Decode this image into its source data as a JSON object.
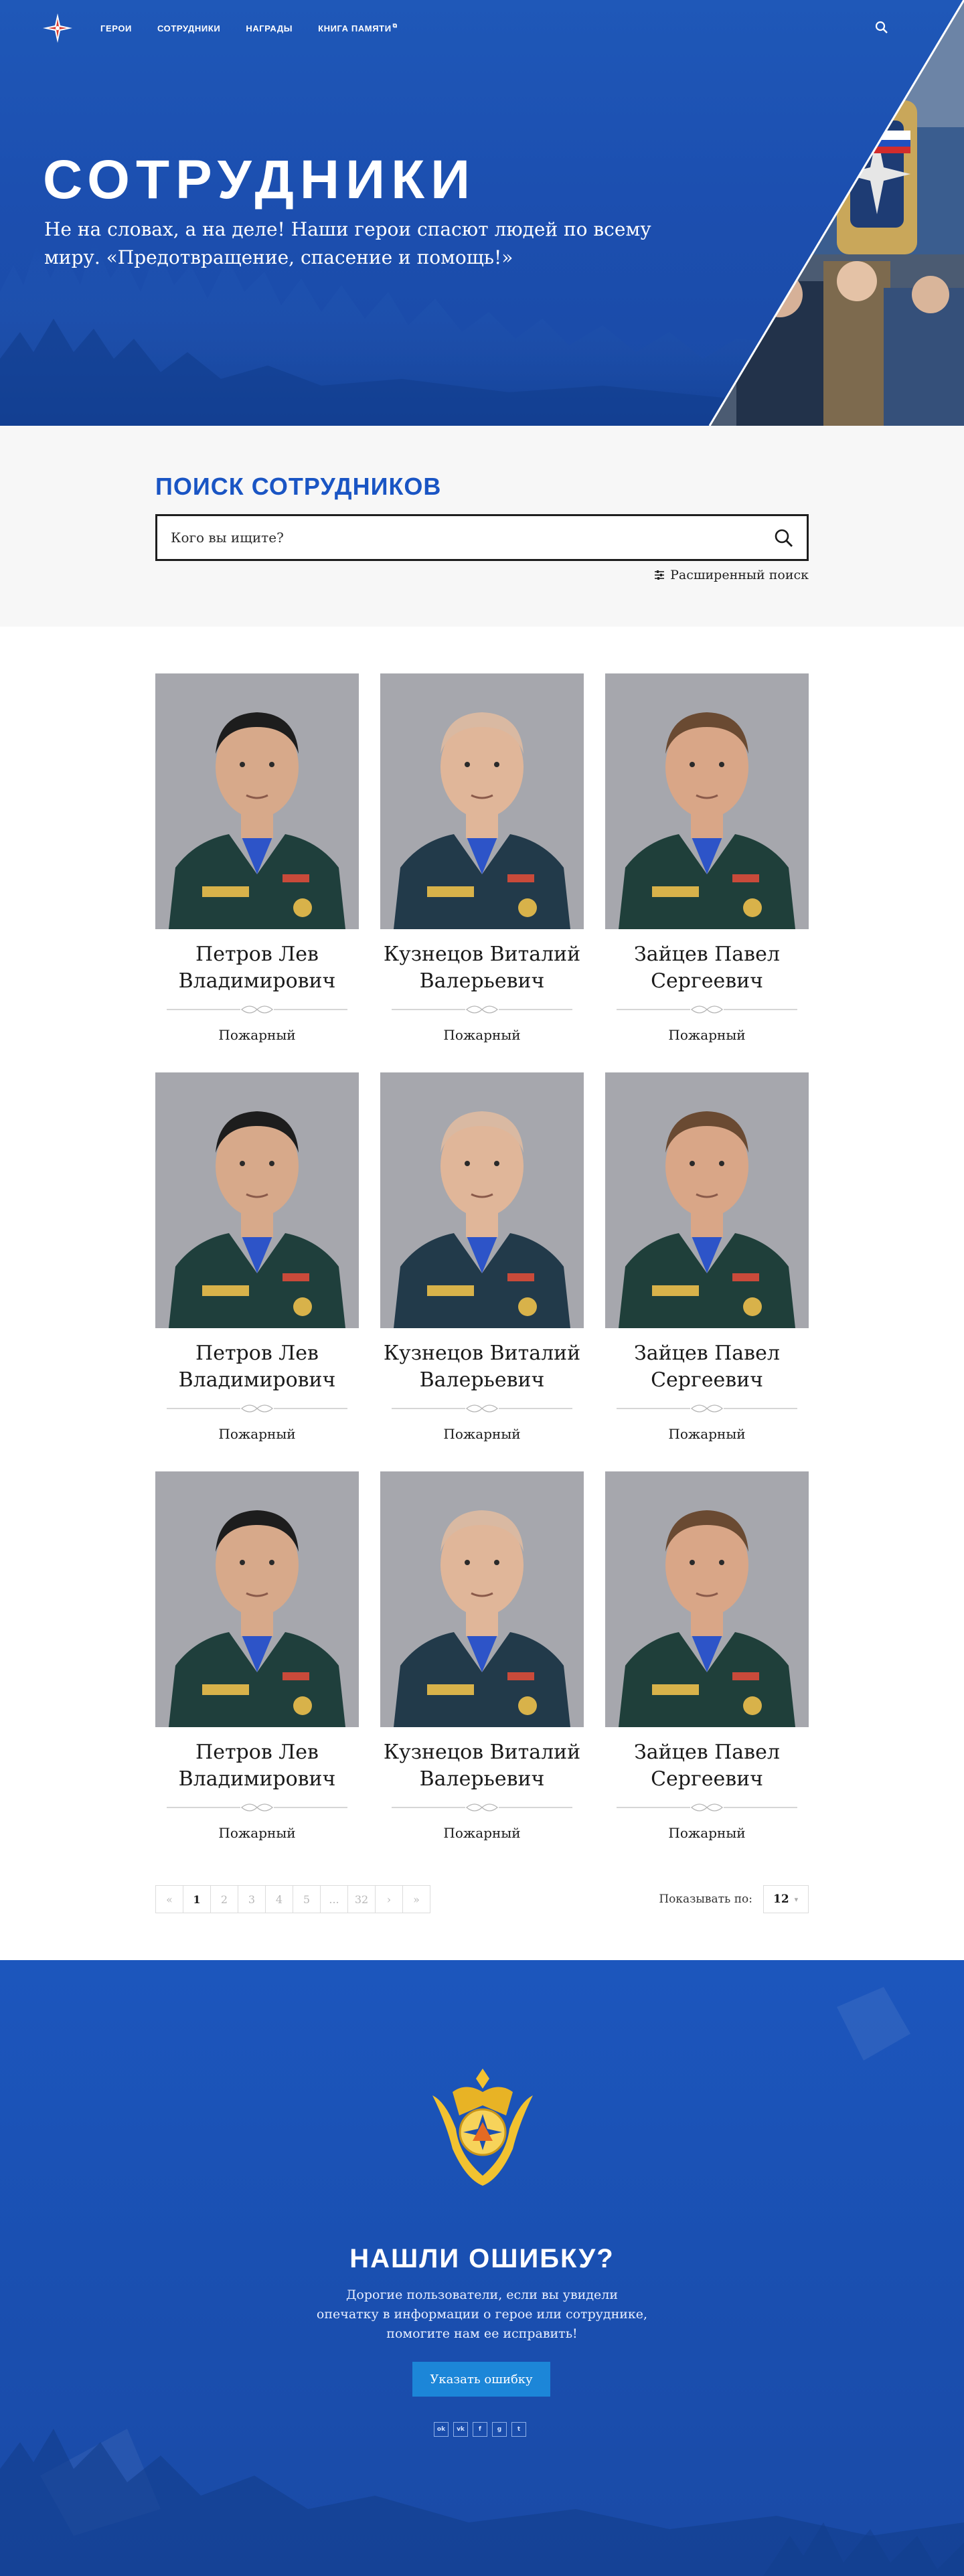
{
  "header": {
    "nav": [
      "Герои",
      "Сотрудники",
      "Награды",
      "Книга памяти"
    ],
    "nav_icons": [
      "logo-star-icon",
      "search-icon",
      "external-link-icon"
    ]
  },
  "hero": {
    "title": "СОТРУДНИКИ",
    "subtitle": "Не на словах, а на деле! Наши герои спасют людей по всему миру. «Предотвращение, спасение и помощь!»"
  },
  "search": {
    "title": "ПОИСК СОТРУДНИКОВ",
    "placeholder": "Кого вы ищите?",
    "advanced_label": "Расширенный поиск"
  },
  "employees": [
    {
      "name": "Петров Лев Владимирович",
      "role": "Пожарный"
    },
    {
      "name": "Кузнецов Виталий Валерьевич",
      "role": "Пожарный"
    },
    {
      "name": "Зайцев Павел Сергеевич",
      "role": "Пожарный"
    },
    {
      "name": "Петров Лев Владимирович",
      "role": "Пожарный"
    },
    {
      "name": "Кузнецов Виталий Валерьевич",
      "role": "Пожарный"
    },
    {
      "name": "Зайцев Павел Сергеевич",
      "role": "Пожарный"
    },
    {
      "name": "Петров Лев Владимирович",
      "role": "Пожарный"
    },
    {
      "name": "Кузнецов Виталий Валерьевич",
      "role": "Пожарный"
    },
    {
      "name": "Зайцев Павел Сергеевич",
      "role": "Пожарный"
    }
  ],
  "pagination": {
    "prev_first": "«",
    "pages": [
      "1",
      "2",
      "3",
      "4",
      "5",
      "...",
      "32"
    ],
    "next": "›",
    "last": "»",
    "current": "1"
  },
  "per_page": {
    "label": "Показывать по:",
    "value": "12"
  },
  "footer": {
    "title": "НАШЛИ ОШИБКУ?",
    "text": "Дорогие пользователи, если вы увидели опечатку в информации о герое или сотруднике, помогите нам ее исправить!",
    "button": "Указать ошибку",
    "socials": [
      "ok-icon",
      "vk-icon",
      "facebook-icon",
      "google-plus-icon",
      "twitter-icon"
    ]
  },
  "colors": {
    "brand_blue": "#1a55c4",
    "hero_blue": "#1c4fb0",
    "button_blue": "#1c86d8"
  }
}
